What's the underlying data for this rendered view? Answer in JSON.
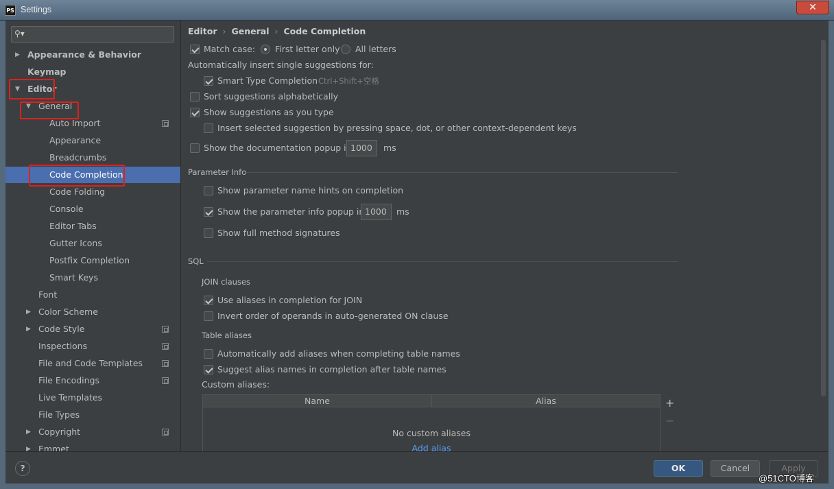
{
  "window": {
    "title": "Settings",
    "app_badge": "PS",
    "close_glyph": "✕"
  },
  "search": {
    "icon": "search-icon",
    "value": ""
  },
  "tree": [
    {
      "label": "Appearance & Behavior",
      "level": 0,
      "bold": true,
      "arrow": "right"
    },
    {
      "label": "Keymap",
      "level": 0,
      "bold": true,
      "arrow": ""
    },
    {
      "label": "Editor",
      "level": 0,
      "bold": true,
      "arrow": "down"
    },
    {
      "label": "General",
      "level": 1,
      "arrow": "down"
    },
    {
      "label": "Auto Import",
      "level": 2,
      "cfg": true
    },
    {
      "label": "Appearance",
      "level": 2
    },
    {
      "label": "Breadcrumbs",
      "level": 2
    },
    {
      "label": "Code Completion",
      "level": 2,
      "selected": true
    },
    {
      "label": "Code Folding",
      "level": 2
    },
    {
      "label": "Console",
      "level": 2
    },
    {
      "label": "Editor Tabs",
      "level": 2
    },
    {
      "label": "Gutter Icons",
      "level": 2
    },
    {
      "label": "Postfix Completion",
      "level": 2
    },
    {
      "label": "Smart Keys",
      "level": 2
    },
    {
      "label": "Font",
      "level": 1
    },
    {
      "label": "Color Scheme",
      "level": 1,
      "arrow": "right"
    },
    {
      "label": "Code Style",
      "level": 1,
      "arrow": "right",
      "cfg": true
    },
    {
      "label": "Inspections",
      "level": 1,
      "cfg": true
    },
    {
      "label": "File and Code Templates",
      "level": 1,
      "cfg": true
    },
    {
      "label": "File Encodings",
      "level": 1,
      "cfg": true
    },
    {
      "label": "Live Templates",
      "level": 1
    },
    {
      "label": "File Types",
      "level": 1
    },
    {
      "label": "Copyright",
      "level": 1,
      "arrow": "right",
      "cfg": true
    },
    {
      "label": "Emmet",
      "level": 1,
      "arrow": "right"
    }
  ],
  "breadcrumb": [
    "Editor",
    "General",
    "Code Completion"
  ],
  "breadcrumb_sep": "›",
  "completion": {
    "match_case": {
      "label": "Match case:",
      "checked": true
    },
    "first_letter": {
      "label": "First letter only",
      "selected": true
    },
    "all_letters": {
      "label": "All letters",
      "selected": false
    },
    "auto_insert_heading": "Automatically insert single suggestions for:",
    "smart_type": {
      "label": "Smart Type Completion",
      "checked": true,
      "shortcut": "Ctrl+Shift+空格"
    },
    "sort_alpha": {
      "label": "Sort suggestions alphabetically",
      "checked": false
    },
    "show_as_type": {
      "label": "Show suggestions as you type",
      "checked": true
    },
    "insert_selected": {
      "label": "Insert selected suggestion by pressing space, dot, or other context-dependent keys",
      "checked": false
    },
    "doc_popup": {
      "label": "Show the documentation popup in",
      "checked": false,
      "value": "1000",
      "unit": "ms"
    }
  },
  "param_info": {
    "title": "Parameter Info",
    "name_hints": {
      "label": "Show parameter name hints on completion",
      "checked": false
    },
    "info_popup": {
      "label": "Show the parameter info popup in",
      "checked": true,
      "value": "1000",
      "unit": "ms"
    },
    "full_sig": {
      "label": "Show full method signatures",
      "checked": false
    }
  },
  "sql": {
    "title": "SQL",
    "join_heading": "JOIN clauses",
    "use_aliases": {
      "label": "Use aliases in completion for JOIN",
      "checked": true
    },
    "invert_order": {
      "label": "Invert order of operands in auto-generated ON clause",
      "checked": false
    },
    "table_heading": "Table aliases",
    "auto_add": {
      "label": "Automatically add aliases when completing table names",
      "checked": false
    },
    "suggest_alias": {
      "label": "Suggest alias names in completion after table names",
      "checked": true
    },
    "custom_label": "Custom aliases:",
    "columns": [
      "Name",
      "Alias"
    ],
    "empty_text": "No custom aliases",
    "add_link": "Add alias",
    "add_btn": "+",
    "remove_btn": "−"
  },
  "footer": {
    "help": "?",
    "ok": "OK",
    "cancel": "Cancel",
    "apply": "Apply"
  },
  "watermark": "@51CTO博客",
  "colors": {
    "selection": "#4b6eaf",
    "highlight": "#e0201b",
    "link": "#589df6"
  }
}
